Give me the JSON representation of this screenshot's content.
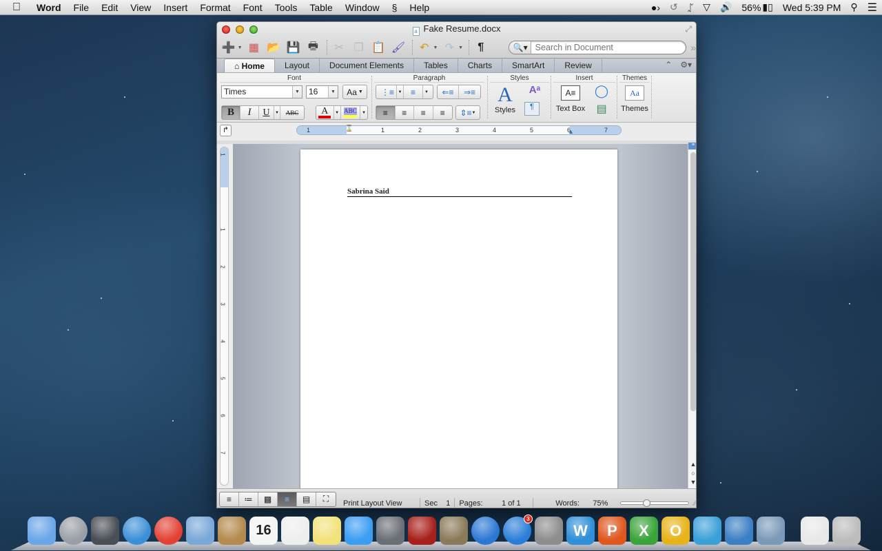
{
  "menubar": {
    "apple_icon": "apple-logo",
    "app_name": "Word",
    "items": [
      "File",
      "Edit",
      "View",
      "Insert",
      "Format",
      "Font",
      "Tools",
      "Table",
      "Window",
      "Script",
      "Help"
    ],
    "script_icon": "§",
    "status": {
      "activity_icon": "activity-monitor-icon",
      "time_machine_icon": "time-machine-icon",
      "bluetooth_icon": "bluetooth-icon",
      "wifi_icon": "wifi-icon",
      "volume_icon": "volume-icon",
      "battery_percent": "56%",
      "clock": "Wed 5:39 PM",
      "spotlight_icon": "spotlight-icon",
      "notification_icon": "notification-center-icon"
    }
  },
  "window": {
    "title": "Fake Resume.docx",
    "doc_icon_glyph": "a",
    "search": {
      "placeholder": "Search in Document",
      "value": ""
    },
    "toolbar": [
      "new",
      "gallery",
      "open",
      "save",
      "print",
      "cut",
      "copy",
      "paste",
      "format-painter",
      "undo",
      "redo",
      "show-formatting"
    ],
    "tabs": [
      {
        "label": "Home",
        "active": true
      },
      {
        "label": "Layout"
      },
      {
        "label": "Document Elements"
      },
      {
        "label": "Tables"
      },
      {
        "label": "Charts"
      },
      {
        "label": "SmartArt"
      },
      {
        "label": "Review"
      }
    ],
    "home_glyph": "⌂",
    "ribbon": {
      "groups": {
        "font": "Font",
        "paragraph": "Paragraph",
        "styles": "Styles",
        "insert": "Insert",
        "themes": "Themes"
      },
      "font_name": "Times",
      "font_size": "16",
      "bold": "B",
      "italic": "I",
      "underline": "U",
      "strike": "ABC",
      "font_color_letter": "A",
      "highlight_text": "ABC",
      "font_color": "#e00000",
      "highlight_color": "#ffff33",
      "styles_label": "Styles",
      "textbox_label": "Text Box",
      "themes_label": "Themes",
      "change_case": "Aa"
    },
    "ruler": {
      "numbers": [
        "1",
        "1",
        "2",
        "3",
        "4",
        "5",
        "6",
        "7"
      ],
      "vertical_numbers": [
        "1",
        "1",
        "2",
        "3",
        "4",
        "5",
        "6",
        "7"
      ]
    },
    "document": {
      "heading": "Sabrina Said"
    },
    "statusbar": {
      "view": "Print Layout View",
      "sec_label": "Sec",
      "sec_value": "1",
      "pages_label": "Pages:",
      "pages_value": "1 of 1",
      "words_label": "Words:",
      "zoom": "75%",
      "zoom_slider_fraction": 0.35
    }
  },
  "dock": {
    "items": [
      {
        "name": "Finder",
        "color": "#6aa6e8"
      },
      {
        "name": "Launchpad",
        "color": "#9a9fa6"
      },
      {
        "name": "Mission Control",
        "color": "#4a4e55"
      },
      {
        "name": "Safari",
        "color": "#3b8fd6"
      },
      {
        "name": "Google Chrome",
        "color": "#e34133"
      },
      {
        "name": "Mail",
        "color": "#7aa8d8"
      },
      {
        "name": "Contacts",
        "color": "#b48a4e"
      },
      {
        "name": "Calendar",
        "color": "#f4f4f4",
        "text": "16"
      },
      {
        "name": "Reminders",
        "color": "#eeeeee"
      },
      {
        "name": "Stickies",
        "color": "#f3e27a"
      },
      {
        "name": "Messages",
        "color": "#3c9df2"
      },
      {
        "name": "FaceTime",
        "color": "#6a6e75"
      },
      {
        "name": "Photo Booth",
        "color": "#a8201a"
      },
      {
        "name": "iPhoto",
        "color": "#8a7a5a"
      },
      {
        "name": "iTunes",
        "color": "#2a77d4"
      },
      {
        "name": "App Store",
        "color": "#2a7ed8",
        "badge": "3"
      },
      {
        "name": "System Preferences",
        "color": "#8d8d8d"
      },
      {
        "name": "Microsoft Word",
        "color": "#2f8fd8",
        "text": "W"
      },
      {
        "name": "Microsoft PowerPoint",
        "color": "#e0571e",
        "text": "P"
      },
      {
        "name": "Microsoft Excel",
        "color": "#3aa43a",
        "text": "X"
      },
      {
        "name": "Microsoft Outlook",
        "color": "#e8b318",
        "text": "O"
      },
      {
        "name": "Microsoft Messenger",
        "color": "#3aa0d8"
      },
      {
        "name": "Microsoft AutoUpdate",
        "color": "#3b7fc4"
      },
      {
        "name": "Remote Desktop Connection",
        "color": "#7a9ab8"
      },
      {
        "name": "Chrome App Folder",
        "color": "#e8e8e8"
      },
      {
        "name": "Trash",
        "color": "#bcbcbc"
      }
    ]
  }
}
